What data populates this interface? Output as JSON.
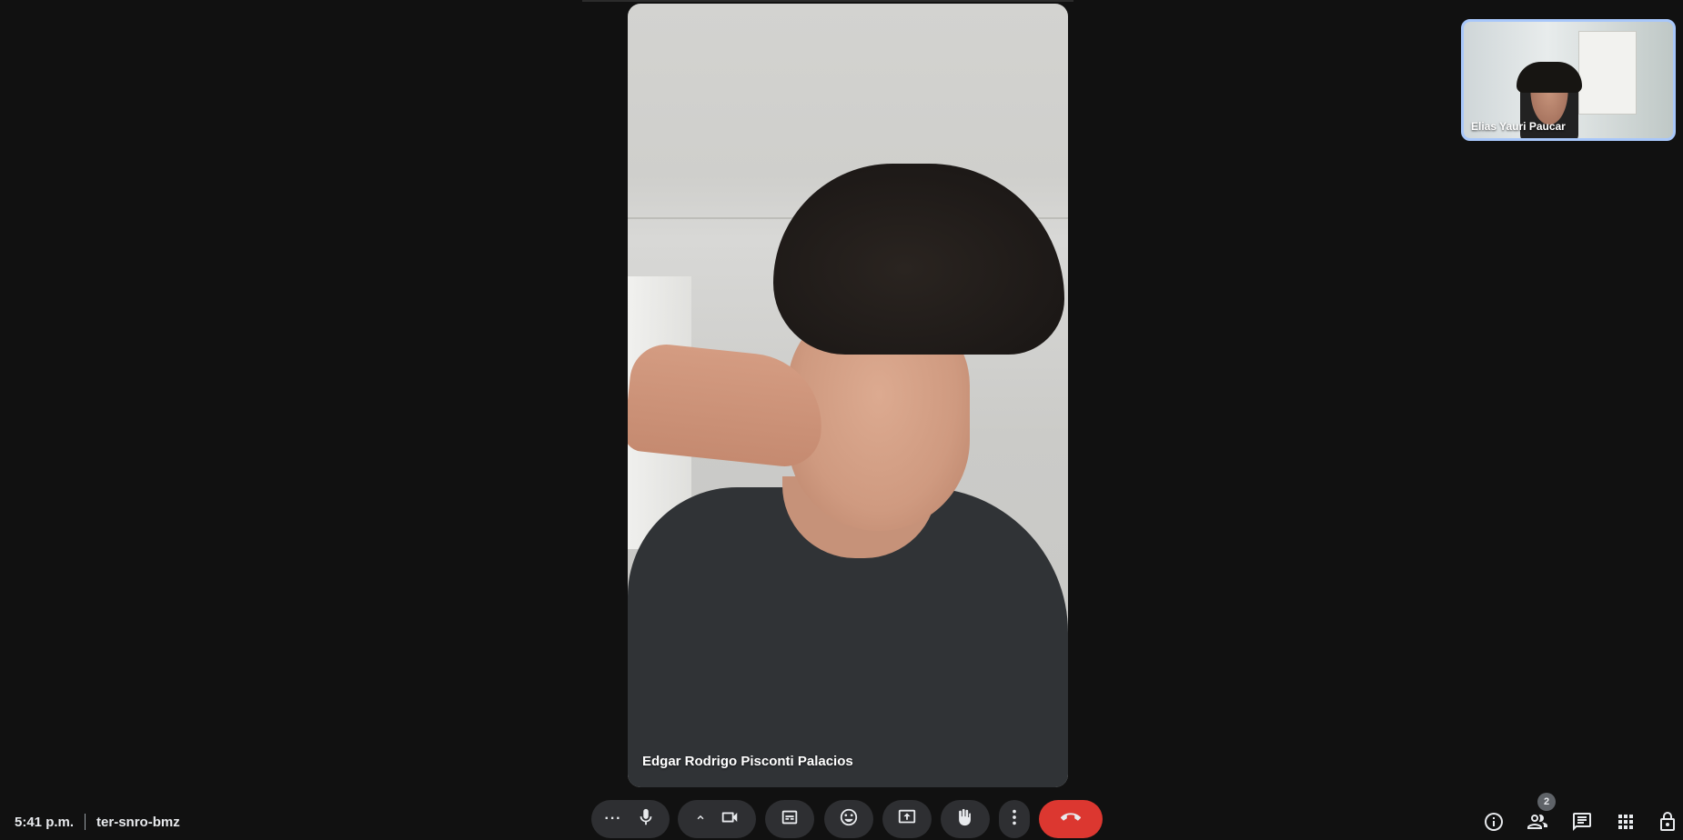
{
  "meeting": {
    "time": "5:41 p.m.",
    "code": "ter-snro-bmz"
  },
  "main_tile": {
    "participant_name": "Edgar Rodrigo Pisconti Palacios"
  },
  "self_tile": {
    "participant_name": "Elias Yauri Paucar"
  },
  "controls": {
    "more_label": "···"
  },
  "people": {
    "count": "2"
  },
  "colors": {
    "background": "#111111",
    "control_bg": "#2e2f32",
    "end_call": "#dc3730",
    "self_tile_border": "#a8c7fa"
  },
  "icons": [
    "more-horiz-icon",
    "mic-icon",
    "chevron-up-icon",
    "camera-icon",
    "captions-icon",
    "emoji-icon",
    "present-icon",
    "hand-icon",
    "more-vert-icon",
    "hangup-icon",
    "info-icon",
    "people-icon",
    "chat-icon",
    "apps-icon",
    "lock-icon"
  ]
}
